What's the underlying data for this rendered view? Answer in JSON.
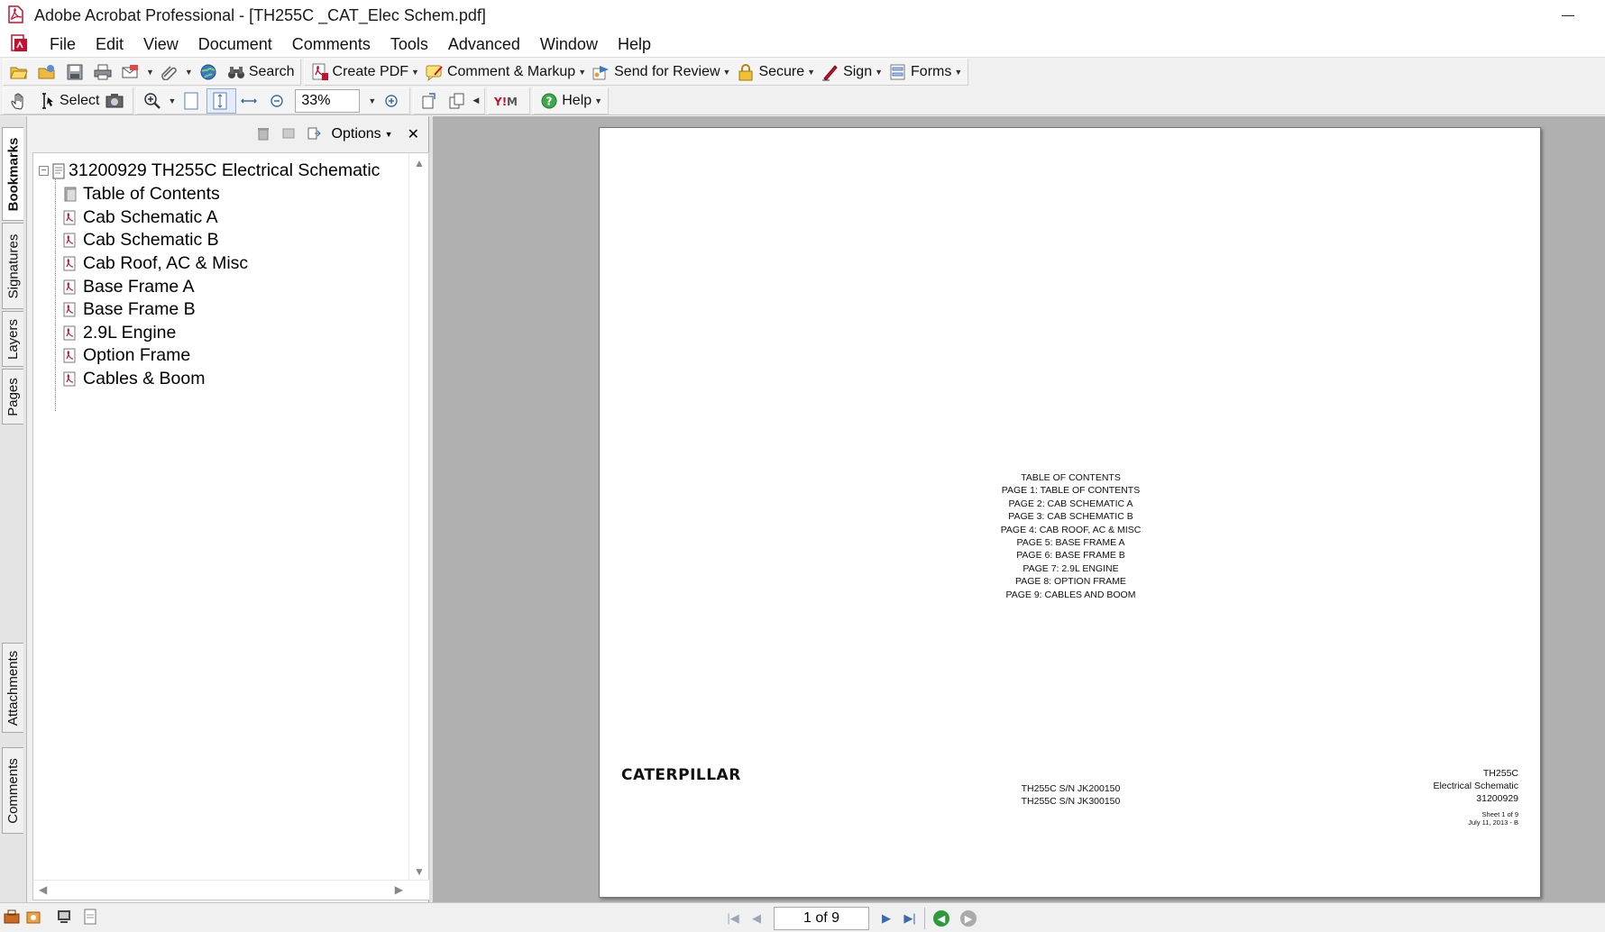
{
  "window": {
    "title": "Adobe Acrobat Professional - [TH255C _CAT_Elec Schem.pdf]"
  },
  "menubar": {
    "items": [
      "File",
      "Edit",
      "View",
      "Document",
      "Comments",
      "Tools",
      "Advanced",
      "Window",
      "Help"
    ]
  },
  "toolbar1": {
    "search_label": "Search",
    "create_pdf_label": "Create PDF",
    "comment_markup_label": "Comment & Markup",
    "send_review_label": "Send for Review",
    "secure_label": "Secure",
    "sign_label": "Sign",
    "forms_label": "Forms"
  },
  "toolbar2": {
    "select_label": "Select",
    "zoom_value": "33%",
    "help_label": "Help"
  },
  "side_tabs": [
    "Bookmarks",
    "Signatures",
    "Layers",
    "Pages",
    "Attachments",
    "Comments"
  ],
  "nav_panel": {
    "options_label": "Options",
    "close_glyph": "✕",
    "root": "31200929 TH255C Electrical Schematic",
    "bookmarks": [
      "Table of Contents",
      "Cab Schematic A",
      "Cab Schematic B",
      "Cab Roof, AC & Misc",
      "Base Frame A",
      "Base Frame B",
      "2.9L Engine",
      "Option Frame",
      "Cables & Boom"
    ]
  },
  "document_page": {
    "toc_lines": [
      "TABLE OF CONTENTS",
      "PAGE 1: TABLE OF CONTENTS",
      "PAGE 2: CAB SCHEMATIC A",
      "PAGE 3: CAB SCHEMATIC B",
      "PAGE 4: CAB ROOF, AC & MISC",
      "PAGE 5: BASE FRAME A",
      "PAGE 6: BASE FRAME B",
      "PAGE 7: 2.9L ENGINE",
      "PAGE 8: OPTION FRAME",
      "PAGE 9: CABLES AND BOOM"
    ],
    "logo_text": "CATERPILLAR",
    "serial_lines": [
      "TH255C S/N JK200150",
      "TH255C S/N JK300150"
    ],
    "title_block": [
      "TH255C",
      "Electrical Schematic",
      "31200929"
    ],
    "sheet": "Sheet 1 of 9",
    "date": "July 11, 2013 - B"
  },
  "statusbar": {
    "page_indicator": "1 of 9"
  },
  "colors": {
    "accent_red": "#c8102e",
    "page_bg": "#ffffff",
    "viewer_bg": "#b0b0b0",
    "chrome_bg": "#f0f0f0"
  }
}
